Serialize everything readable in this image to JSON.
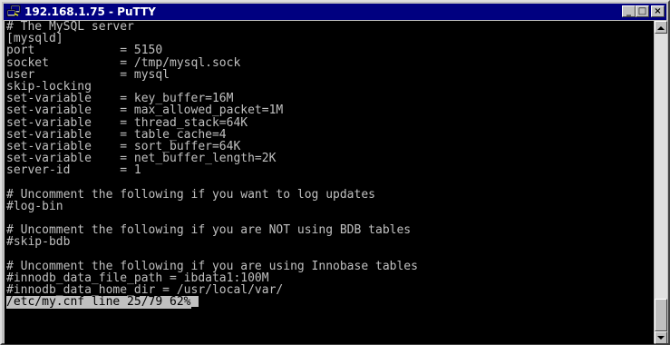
{
  "window": {
    "title": "192.168.1.75 - PuTTY",
    "minimize_label": "_",
    "maximize_label": "□",
    "close_label": "×"
  },
  "terminal": {
    "lines": [
      "# The MySQL server",
      "[mysqld]",
      "port            = 5150",
      "socket          = /tmp/mysql.sock",
      "user            = mysql",
      "skip-locking",
      "set-variable    = key_buffer=16M",
      "set-variable    = max_allowed_packet=1M",
      "set-variable    = thread_stack=64K",
      "set-variable    = table_cache=4",
      "set-variable    = sort_buffer=64K",
      "set-variable    = net_buffer_length=2K",
      "server-id       = 1",
      "",
      "# Uncomment the following if you want to log updates",
      "#log-bin",
      "",
      "# Uncomment the following if you are NOT using BDB tables",
      "#skip-bdb",
      "",
      "# Uncomment the following if you are using Innobase tables",
      "#innodb_data_file_path = ibdata1:100M",
      "#innodb_data_home_dir = /usr/local/var/"
    ],
    "status": "/etc/my.cnf line 25/79 62%"
  },
  "scrollbar": {
    "position_fraction": 0.62
  },
  "colors": {
    "titlebar": "#000080",
    "terminal_bg": "#000000",
    "terminal_fg": "#c0c0c0"
  }
}
